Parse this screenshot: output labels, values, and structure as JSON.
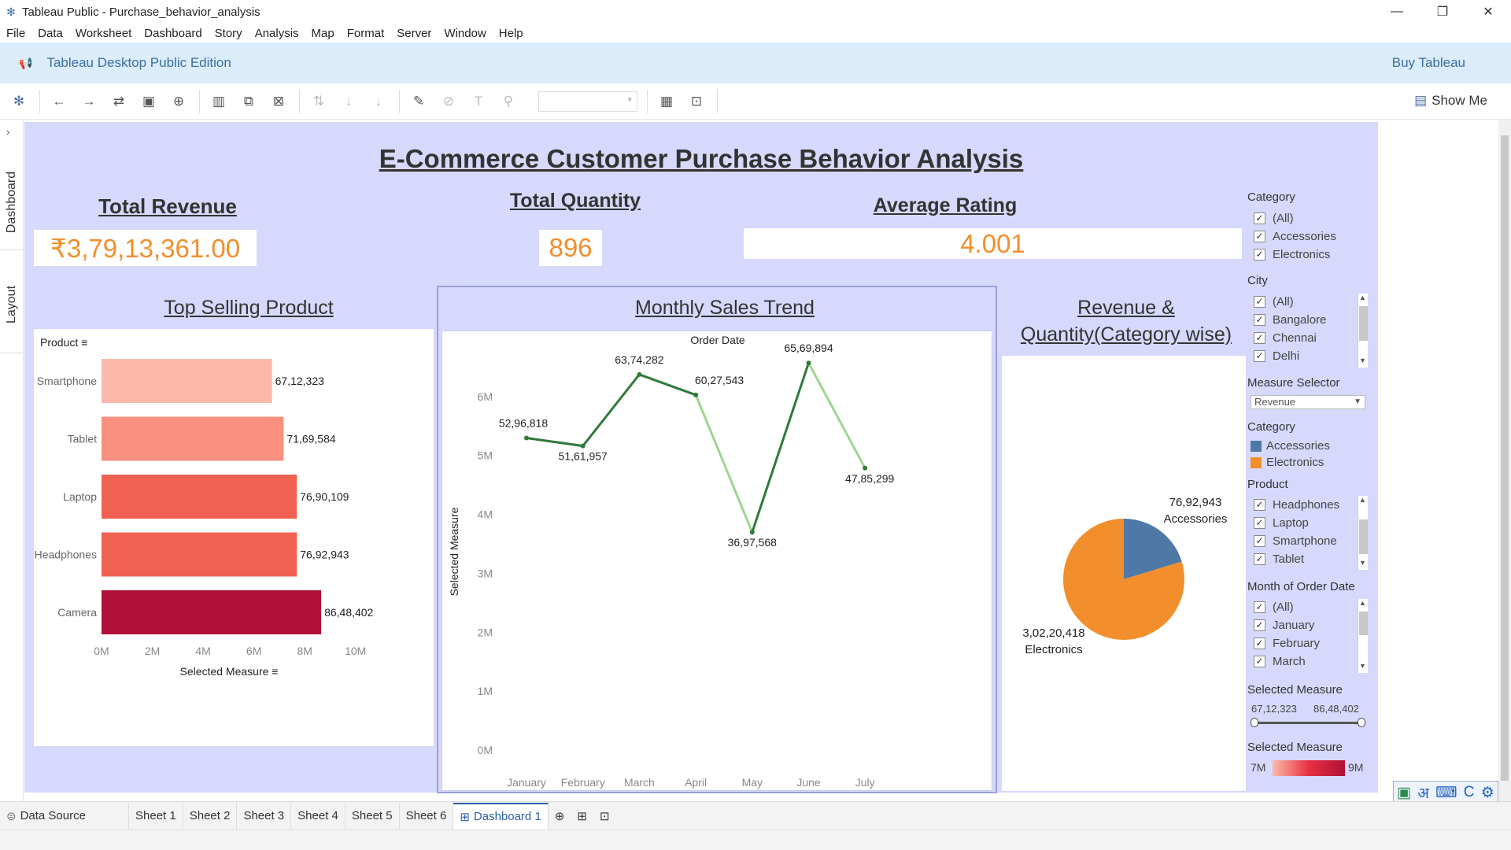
{
  "window": {
    "title": "Tableau Public - Purchase_behavior_analysis",
    "min": "—",
    "restore": "❐",
    "close": "✕"
  },
  "menu": [
    "File",
    "Data",
    "Worksheet",
    "Dashboard",
    "Story",
    "Analysis",
    "Map",
    "Format",
    "Server",
    "Window",
    "Help"
  ],
  "banner": {
    "edition": "Tableau Desktop Public Edition",
    "buy": "Buy Tableau"
  },
  "toolbar": {
    "show_me": "Show Me"
  },
  "left_tabs": {
    "dashboard": "Dashboard",
    "layout": "Layout"
  },
  "dashboard": {
    "title": "E-Commerce Customer Purchase Behavior Analysis",
    "kpis": {
      "revenue_title": "Total Revenue",
      "revenue_value": "₹3,79,13,361.00",
      "quantity_title": "Total Quantity",
      "quantity_value": "896",
      "rating_title": "Average Rating",
      "rating_value": "4.001"
    },
    "top_selling_title": "Top Selling Product",
    "monthly_title": "Monthly Sales Trend",
    "category_title_line1": "Revenue &",
    "category_title_line2": "Quantity(Category wise)"
  },
  "chart_data": [
    {
      "type": "bar",
      "orientation": "horizontal",
      "row_header": "Product",
      "xlabel": "Selected Measure",
      "categories": [
        "Smartphone",
        "Tablet",
        "Laptop",
        "Headphones",
        "Camera"
      ],
      "values": [
        6712323,
        7169584,
        7690109,
        7692943,
        8648402
      ],
      "labels": [
        "67,12,323",
        "71,69,584",
        "76,90,109",
        "76,92,943",
        "86,48,402"
      ],
      "colors": [
        "#fcb9aa",
        "#f98f7e",
        "#f06152",
        "#f06152",
        "#b01038"
      ],
      "xlim": [
        0,
        11000000
      ],
      "xticks": [
        0,
        2000000,
        4000000,
        6000000,
        8000000,
        10000000
      ],
      "xtick_labels": [
        "0M",
        "2M",
        "4M",
        "6M",
        "8M",
        "10M"
      ]
    },
    {
      "type": "line",
      "header": "Order Date",
      "ylabel": "Selected Measure",
      "categories": [
        "January",
        "February",
        "March",
        "April",
        "May",
        "June",
        "July"
      ],
      "values": [
        5296818,
        5161957,
        6374282,
        6027543,
        3697568,
        6569894,
        4785299
      ],
      "labels": [
        "52,96,818",
        "51,61,957",
        "63,74,282",
        "60,27,543",
        "36,97,568",
        "65,69,894",
        "47,85,299"
      ],
      "ylim": [
        0,
        7000000
      ],
      "yticks": [
        0,
        1000000,
        2000000,
        3000000,
        4000000,
        5000000,
        6000000
      ],
      "ytick_labels": [
        "0M",
        "1M",
        "2M",
        "3M",
        "4M",
        "5M",
        "6M"
      ],
      "color_dark": "#2f7a3a",
      "color_light": "#9fd58f"
    },
    {
      "type": "pie",
      "categories": [
        "Accessories",
        "Electronics"
      ],
      "values": [
        7692943,
        30220418
      ],
      "labels": [
        "76,92,943",
        "3,02,20,418"
      ],
      "colors": [
        "#4e79a7",
        "#f28e2b"
      ]
    }
  ],
  "filters": {
    "category_title": "Category",
    "category_items": [
      "(All)",
      "Accessories",
      "Electronics"
    ],
    "city_title": "City",
    "city_items": [
      "(All)",
      "Bangalore",
      "Chennai",
      "Delhi"
    ],
    "measure_selector_title": "Measure Selector",
    "measure_selector_value": "Revenue",
    "legend_title": "Category",
    "legend_items": [
      {
        "label": "Accessories",
        "color": "#4e79a7"
      },
      {
        "label": "Electronics",
        "color": "#f28e2b"
      }
    ],
    "product_title": "Product",
    "product_items": [
      "Headphones",
      "Laptop",
      "Smartphone",
      "Tablet"
    ],
    "month_title": "Month of Order Date",
    "month_items": [
      "(All)",
      "January",
      "February",
      "March"
    ],
    "range_title": "Selected Measure",
    "range_min": "67,12,323",
    "range_max": "86,48,402",
    "color_legend_title": "Selected Measure",
    "color_min": "7M",
    "color_max": "9M",
    "check": "✓"
  },
  "tabs": {
    "data_source": "Data Source",
    "sheets": [
      "Sheet 1",
      "Sheet 2",
      "Sheet 3",
      "Sheet 4",
      "Sheet 5",
      "Sheet 6"
    ],
    "active": "Dashboard 1"
  },
  "ime": {
    "hindi": "अ",
    "c": "C"
  }
}
